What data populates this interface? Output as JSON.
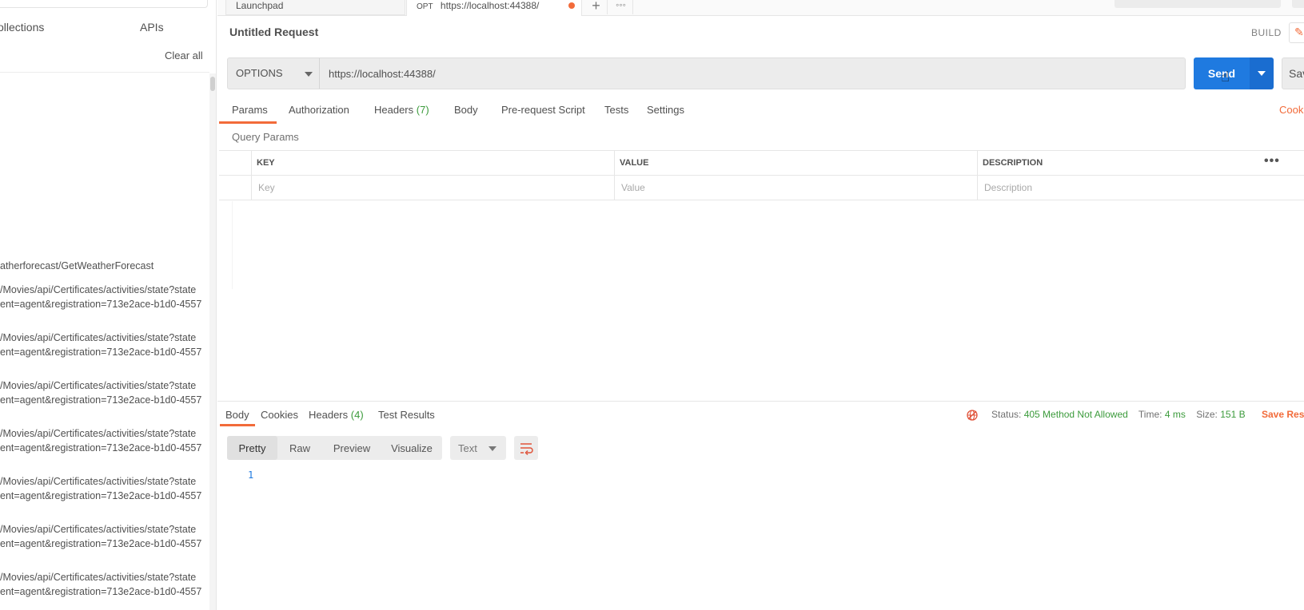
{
  "sidebar": {
    "tab_collections": "ollections",
    "tab_apis": "APIs",
    "clear_all": "Clear all",
    "history": [
      {
        "line1": "atherforecast/GetWeatherForecast"
      },
      {
        "line1": "/Movies/api/Certificates/activities/state?state",
        "line2": "ent=agent&registration=713e2ace-b1d0-4557"
      },
      {
        "line1": "/Movies/api/Certificates/activities/state?state",
        "line2": "ent=agent&registration=713e2ace-b1d0-4557"
      },
      {
        "line1": "/Movies/api/Certificates/activities/state?state",
        "line2": "ent=agent&registration=713e2ace-b1d0-4557"
      },
      {
        "line1": "/Movies/api/Certificates/activities/state?state",
        "line2": "ent=agent&registration=713e2ace-b1d0-4557"
      },
      {
        "line1": "/Movies/api/Certificates/activities/state?state",
        "line2": "ent=agent&registration=713e2ace-b1d0-4557"
      },
      {
        "line1": "/Movies/api/Certificates/activities/state?state",
        "line2": "ent=agent&registration=713e2ace-b1d0-4557"
      },
      {
        "line1": "/Movies/api/Certificates/activities/state?state",
        "line2": "ent=agent&registration=713e2ace-b1d0-4557"
      }
    ]
  },
  "tabs": {
    "launchpad": "Launchpad",
    "active_method": "OPT",
    "active_url": "https://localhost:44388/",
    "plus_icon": "plus-icon",
    "more_icon": "ellipsis-icon"
  },
  "request": {
    "title": "Untitled Request",
    "build_label": "BUILD",
    "method": "OPTIONS",
    "url": "https://localhost:44388/",
    "send_label": "Send",
    "save_label": "Sav",
    "tabs": {
      "params": "Params",
      "authorization": "Authorization",
      "headers": "Headers",
      "headers_count": "(7)",
      "body": "Body",
      "prerequest": "Pre-request Script",
      "tests": "Tests",
      "settings": "Settings"
    },
    "cookies_link": "Cooki",
    "query_params_label": "Query Params",
    "columns": {
      "key": "KEY",
      "value": "VALUE",
      "description": "DESCRIPTION"
    },
    "placeholders": {
      "key": "Key",
      "value": "Value",
      "description": "Description"
    }
  },
  "response": {
    "tabs": {
      "body": "Body",
      "cookies": "Cookies",
      "headers": "Headers",
      "headers_count": "(4)",
      "test_results": "Test Results"
    },
    "status_label": "Status:",
    "status_value": "405 Method Not Allowed",
    "time_label": "Time:",
    "time_value": "4 ms",
    "size_label": "Size:",
    "size_value": "151 B",
    "save_response": "Save Resp",
    "formats": {
      "pretty": "Pretty",
      "raw": "Raw",
      "preview": "Preview",
      "visualize": "Visualize"
    },
    "text_type": "Text",
    "line_number": "1"
  },
  "colors": {
    "accent": "#f26b3a",
    "send_blue": "#1f7ae0",
    "success_green": "#3c9b3c"
  }
}
